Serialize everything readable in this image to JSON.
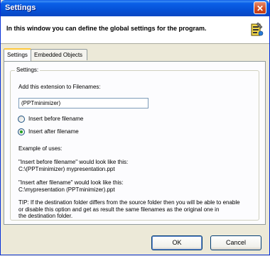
{
  "window": {
    "title": "Settings"
  },
  "header": {
    "description": "In this window you can define the global settings for the program."
  },
  "tabs": [
    {
      "label": "Settings",
      "active": true
    },
    {
      "label": "Embedded Objects",
      "active": false
    }
  ],
  "settings": {
    "group_label": "Settings:",
    "extension_label": "Add this extension to Filenames:",
    "extension_value": "(PPTminimizer)",
    "radio_before_label": "Insert before filename",
    "radio_after_label": "Insert after filename",
    "selected_option": "after",
    "example_heading": "Example of uses:",
    "example_before_line1": "\"Insert before filename\" would look like this:",
    "example_before_line2": "C:\\(PPTminimizer) mypresentation.ppt",
    "example_after_line1": "\"Insert after filename\" would look like this:",
    "example_after_line2": "C:\\mypresentation (PPTminimizer).ppt",
    "tip_line1": "TIP: If the destination folder differs from the source folder then you will be able to enable",
    "tip_line2": "or disable this option and get as result the same filenames as the original one in",
    "tip_line3": "the destination folder."
  },
  "buttons": {
    "ok": "OK",
    "cancel": "Cancel"
  },
  "colors": {
    "title_bar": "#0B60E8",
    "dialog_bg": "#ECE9D8",
    "radio_dot": "#21A121",
    "tab_highlight": "#FFC83C"
  },
  "icons": {
    "close": "close-icon",
    "header": "settings-tools-icon"
  }
}
